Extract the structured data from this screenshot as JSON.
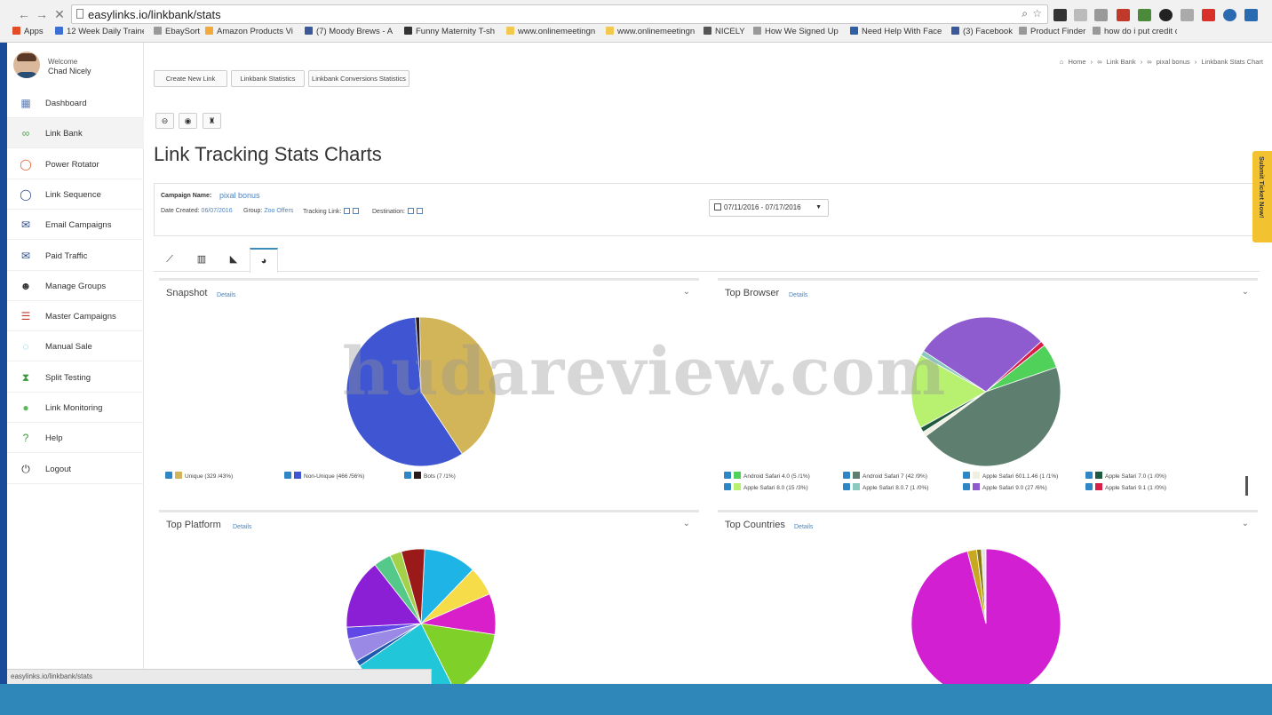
{
  "browser": {
    "url": "easylinks.io/linkbank/stats",
    "status_url": "easylinks.io/linkbank/stats",
    "bookmarks": [
      {
        "label": "Apps",
        "color": "#e34c26"
      },
      {
        "label": "12 Week Daily Traine",
        "color": "#3b6fd4"
      },
      {
        "label": "EbaySort",
        "color": "#999999"
      },
      {
        "label": "Amazon Products Vi",
        "color": "#f2a93b"
      },
      {
        "label": "(7) Moody Brews - A",
        "color": "#3b5998"
      },
      {
        "label": "Funny Maternity T-sh",
        "color": "#333333"
      },
      {
        "label": "www.onlinemeetingn",
        "color": "#f2c94c"
      },
      {
        "label": "www.onlinemeetingn",
        "color": "#f2c94c"
      },
      {
        "label": "NICELY",
        "color": "#555555"
      },
      {
        "label": "How We Signed Up",
        "color": "#999999"
      },
      {
        "label": "Need Help With Face",
        "color": "#2f5fa5"
      },
      {
        "label": "(3) Facebook",
        "color": "#3b5998"
      },
      {
        "label": "Product Finder",
        "color": "#999999"
      },
      {
        "label": "how do i put credit c",
        "color": "#999999"
      }
    ]
  },
  "sidebar": {
    "welcome": "Welcome",
    "user": "Chad Nicely",
    "items": [
      {
        "label": "Dashboard",
        "icon": "dashboard-icon",
        "glyph": "▦",
        "color": "#5b7ab8"
      },
      {
        "label": "Link Bank",
        "icon": "link-icon",
        "glyph": "∞",
        "color": "#4aa34a"
      },
      {
        "label": "Power Rotator",
        "icon": "rotator-icon",
        "glyph": "◯",
        "color": "#e05a2a"
      },
      {
        "label": "Link Sequence",
        "icon": "sequence-icon",
        "glyph": "◯",
        "color": "#2a4a8a"
      },
      {
        "label": "Email Campaigns",
        "icon": "envelope-icon",
        "glyph": "✉",
        "color": "#2a4a8a"
      },
      {
        "label": "Paid Traffic",
        "icon": "mail-icon",
        "glyph": "✉",
        "color": "#2a4a8a"
      },
      {
        "label": "Manage Groups",
        "icon": "users-icon",
        "glyph": "☻",
        "color": "#333333"
      },
      {
        "label": "Master Campaigns",
        "icon": "list-icon",
        "glyph": "☰",
        "color": "#c0392b"
      },
      {
        "label": "Manual Sale",
        "icon": "spinner-icon",
        "glyph": "◌",
        "color": "#4fc0d0"
      },
      {
        "label": "Split Testing",
        "icon": "hourglass-icon",
        "glyph": "⧗",
        "color": "#3a9a3a"
      },
      {
        "label": "Link Monitoring",
        "icon": "globe-icon",
        "glyph": "●",
        "color": "#5cb85c"
      },
      {
        "label": "Help",
        "icon": "help-icon",
        "glyph": "?",
        "color": "#3a9a3a"
      },
      {
        "label": "Logout",
        "icon": "power-icon",
        "glyph": "⏻",
        "color": "#333333"
      }
    ]
  },
  "toolbar": {
    "create_link": "Create New Link",
    "linkbank_stats": "Linkbank Statistics",
    "conversion_stats": "Linkbank Conversions Statistics"
  },
  "breadcrumb": [
    "Home",
    "Link Bank",
    "pixal bonus",
    "Linkbank Stats Chart"
  ],
  "page_title": "Link Tracking Stats Charts",
  "campaign": {
    "name_label": "Campaign Name:",
    "name": "pixal bonus",
    "date_label": "Date Created:",
    "date": "06/07/2016",
    "group_label": "Group:",
    "group": "Zoo Offers",
    "tracking_label": "Tracking Link:",
    "destination_label": "Destination:",
    "date_range": "07/11/2016 - 07/17/2016"
  },
  "panels": {
    "snapshot": {
      "title": "Snapshot",
      "details": "Details"
    },
    "top_browser": {
      "title": "Top Browser",
      "details": "Details"
    },
    "top_platform": {
      "title": "Top Platform",
      "details": "Details"
    },
    "top_countries": {
      "title": "Top Countries",
      "details": "Details"
    }
  },
  "ticket": "Submit Ticket Now!",
  "watermark": "hudareview.com",
  "chart_data": [
    {
      "type": "pie",
      "title": "Snapshot",
      "categories": [
        "Unique (329 /43%)",
        "Non-Unique (466 /56%)",
        "Bots (7 /1%)"
      ],
      "values": [
        329,
        466,
        7
      ],
      "colors": [
        "#d2b558",
        "#3f55d1",
        "#2a1a1a"
      ]
    },
    {
      "type": "pie",
      "title": "Top Browser",
      "categories": [
        "Android Safari 4.0 (5 /1%)",
        "Android Safari 7 (42 /9%)",
        "Apple Safari 601.1.46 (1 /1%)",
        "Apple Safari 7.0 (1 /0%)",
        "Apple Safari 8.0 (15 /3%)",
        "Apple Safari 8.0.7 (1 /0%)",
        "Apple Safari 9.0 (27 /6%)",
        "Apple Safari 9.1 (1 /0%)"
      ],
      "values": [
        5,
        42,
        1,
        1,
        15,
        1,
        27,
        1
      ],
      "colors": [
        "#4fd15a",
        "#5e7f70",
        "#f0f0e0",
        "#1f5a3f",
        "#b8f070",
        "#8ac8c0",
        "#8e5ccf",
        "#d81f4a"
      ]
    },
    {
      "type": "pie",
      "title": "Top Platform",
      "values": [
        9,
        5,
        7,
        12,
        18,
        1,
        4,
        2,
        12,
        3,
        2,
        4
      ],
      "colors": [
        "#1fb4e6",
        "#f5dc48",
        "#d81fc9",
        "#7fd12a",
        "#21c7d9",
        "#1f5ab0",
        "#9a8ae6",
        "#5f48e6",
        "#8a1fd6",
        "#55c98a",
        "#a4d14a",
        "#9a1a1a"
      ]
    },
    {
      "type": "pie",
      "title": "Top Countries",
      "values": [
        96,
        2,
        1,
        1
      ],
      "colors": [
        "#d11fd1",
        "#c8a820",
        "#8a7a10",
        "#e5e5e5"
      ]
    }
  ]
}
